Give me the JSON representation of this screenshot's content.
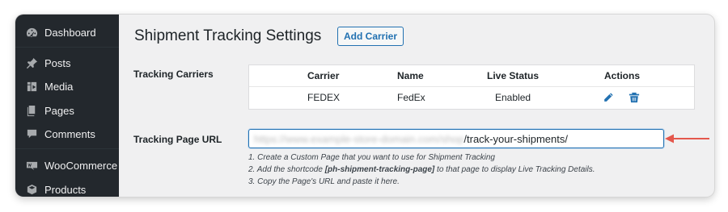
{
  "sidebar": {
    "items": [
      {
        "label": "Dashboard",
        "icon": "dashboard-icon"
      },
      {
        "label": "Posts",
        "icon": "pin-icon"
      },
      {
        "label": "Media",
        "icon": "media-icon"
      },
      {
        "label": "Pages",
        "icon": "pages-icon"
      },
      {
        "label": "Comments",
        "icon": "comments-icon"
      },
      {
        "label": "WooCommerce",
        "icon": "woocommerce-icon"
      },
      {
        "label": "Products",
        "icon": "products-icon"
      }
    ]
  },
  "page": {
    "title": "Shipment Tracking Settings",
    "add_carrier_label": "Add Carrier"
  },
  "carriers": {
    "section_label": "Tracking Carriers",
    "headers": {
      "carrier": "Carrier",
      "name": "Name",
      "live_status": "Live Status",
      "actions": "Actions"
    },
    "rows": [
      {
        "carrier": "FEDEX",
        "name": "FedEx",
        "live_status": "Enabled"
      }
    ]
  },
  "tracking_page": {
    "label": "Tracking Page URL",
    "url_visible_suffix": "/track-your-shipments/",
    "url_blurred_prefix": "https://www.example-store-domain.com/shop",
    "help_line1": "1. Create a Custom Page that you want to use for Shipment Tracking",
    "help_line2_prefix": "2. Add the shortcode ",
    "help_line2_shortcode": "[ph-shipment-tracking-page]",
    "help_line2_suffix": " to that page to display Live Tracking Details.",
    "help_line3": "3. Copy the Page's URL and paste it here."
  },
  "colors": {
    "sidebar_bg": "#23282d",
    "accent": "#2271b1",
    "arrow": "#e4574c"
  }
}
